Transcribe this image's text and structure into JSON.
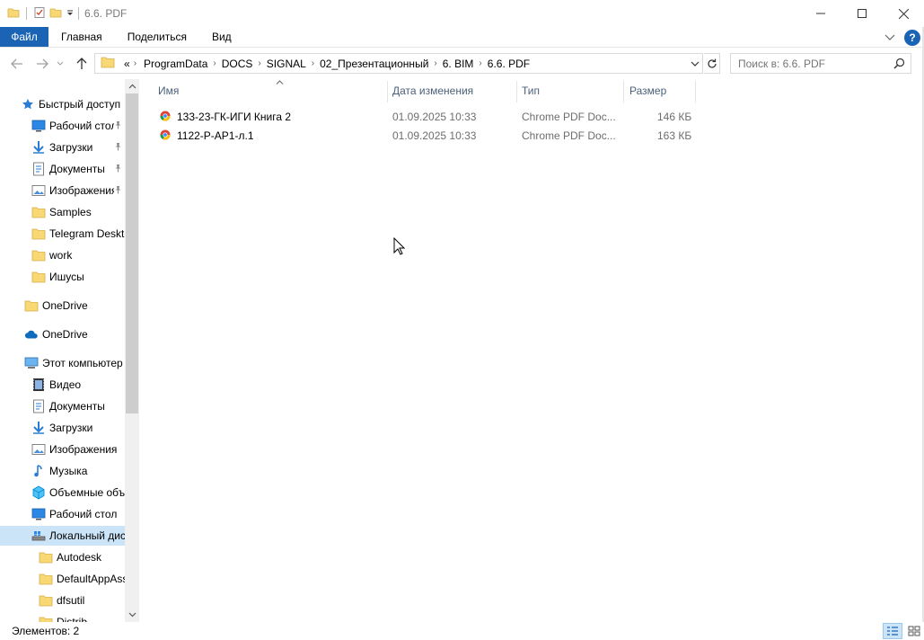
{
  "window": {
    "title": "6.6. PDF"
  },
  "ribbon": {
    "file_tab": "Файл",
    "tabs": [
      "Главная",
      "Поделиться",
      "Вид"
    ]
  },
  "address": {
    "overflow": "«",
    "crumbs": [
      "ProgramData",
      "DOCS",
      "SIGNAL",
      "02_Презентационный",
      "6. BIM",
      "6.6. PDF"
    ]
  },
  "search": {
    "placeholder": "Поиск в: 6.6. PDF"
  },
  "sidebar": {
    "items": [
      {
        "label": "Быстрый доступ",
        "icon": "star-icon",
        "pinned": false
      },
      {
        "label": "Рабочий стол",
        "icon": "desktop-icon",
        "pinned": true
      },
      {
        "label": "Загрузки",
        "icon": "download-icon",
        "pinned": true
      },
      {
        "label": "Документы",
        "icon": "documents-icon",
        "pinned": true
      },
      {
        "label": "Изображения",
        "icon": "pictures-icon",
        "pinned": true
      },
      {
        "label": "Samples",
        "icon": "folder-icon",
        "pinned": false
      },
      {
        "label": "Telegram Desktop",
        "icon": "folder-icon",
        "pinned": false
      },
      {
        "label": "work",
        "icon": "folder-icon",
        "pinned": false
      },
      {
        "label": "Ишусы",
        "icon": "folder-icon",
        "pinned": false
      },
      {
        "label": "OneDrive",
        "icon": "folder-icon",
        "pinned": false
      },
      {
        "label": "OneDrive",
        "icon": "cloud-icon",
        "pinned": false
      },
      {
        "label": "Этот компьютер",
        "icon": "computer-icon",
        "pinned": false
      },
      {
        "label": "Видео",
        "icon": "video-icon",
        "pinned": false
      },
      {
        "label": "Документы",
        "icon": "documents-icon",
        "pinned": false
      },
      {
        "label": "Загрузки",
        "icon": "download-icon",
        "pinned": false
      },
      {
        "label": "Изображения",
        "icon": "pictures-icon",
        "pinned": false
      },
      {
        "label": "Музыка",
        "icon": "music-icon",
        "pinned": false
      },
      {
        "label": "Объемные объекты",
        "icon": "3d-objects-icon",
        "pinned": false
      },
      {
        "label": "Рабочий стол",
        "icon": "desktop-icon",
        "pinned": false
      },
      {
        "label": "Локальный диск (C:)",
        "icon": "drive-icon",
        "pinned": false,
        "selected": true
      },
      {
        "label": "Autodesk",
        "icon": "folder-icon",
        "pinned": false
      },
      {
        "label": "DefaultAppAssets",
        "icon": "folder-icon",
        "pinned": false
      },
      {
        "label": "dfsutil",
        "icon": "folder-icon",
        "pinned": false
      },
      {
        "label": "Distrib",
        "icon": "folder-icon",
        "pinned": false
      }
    ]
  },
  "columns": {
    "name": "Имя",
    "date": "Дата изменения",
    "type": "Тип",
    "size": "Размер"
  },
  "files": [
    {
      "name": "133-23-ГК-ИГИ Книга 2",
      "date": "01.09.2025 10:33",
      "type": "Chrome PDF Doc...",
      "size": "146 КБ"
    },
    {
      "name": "1122-Р-АР1-л.1",
      "date": "01.09.2025 10:33",
      "type": "Chrome PDF Doc...",
      "size": "163 КБ"
    }
  ],
  "status": {
    "items_count": "Элементов: 2"
  }
}
